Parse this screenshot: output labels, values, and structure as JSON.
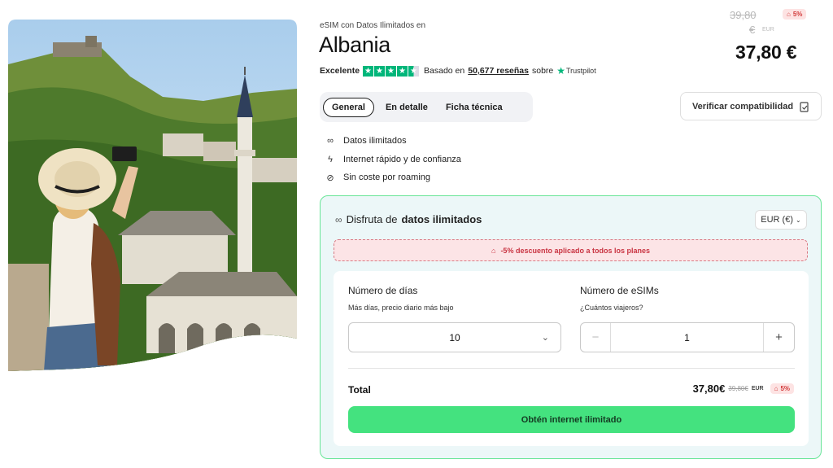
{
  "product": {
    "eyebrow": "eSIM con Datos Ilimitados en",
    "title": "Albania",
    "rating_label": "Excelente",
    "reviews_prefix": "Basado en",
    "reviews_count": "50,677 reseñas",
    "reviews_suffix": "sobre",
    "trustpilot": "Trustpilot",
    "stars": 4.5
  },
  "pricing": {
    "old_price": "39,80",
    "old_currency_symbol": "€",
    "old_currency_code": "EUR",
    "discount_badge": "5%",
    "price": "37,80 €"
  },
  "tabs": [
    {
      "label": "General",
      "active": true
    },
    {
      "label": "En detalle",
      "active": false
    },
    {
      "label": "Ficha técnica",
      "active": false
    }
  ],
  "compat_button": "Verificar compatibilidad",
  "features": [
    {
      "icon": "infinity-icon",
      "label": "Datos ilimitados"
    },
    {
      "icon": "bolt-icon",
      "label": "Internet rápido y de confianza"
    },
    {
      "icon": "no-roaming-icon",
      "label": "Sin coste por roaming"
    }
  ],
  "plan": {
    "heading_prefix": "Disfruta de",
    "heading_bold": "datos ilimitados",
    "currency_select": "EUR (€)",
    "discount_message": "-5% descuento aplicado a todos los planes",
    "days_label": "Número de días",
    "days_hint": "Más días, precio diario más bajo",
    "days_value": "10",
    "esims_label": "Número de eSIMs",
    "esims_hint": "¿Cuántos viajeros?",
    "esims_value": "1",
    "minus": "−",
    "plus": "+",
    "total_label": "Total",
    "total_price": "37,80€",
    "total_old": "39,80€",
    "total_currency": "EUR",
    "total_badge": "5%",
    "cta": "Obtén internet ilimitado"
  },
  "colors": {
    "accent_green": "#44e27f",
    "trustpilot_green": "#00b67a",
    "discount_red": "#d23b3b",
    "panel_bg": "#ecf7f8"
  }
}
